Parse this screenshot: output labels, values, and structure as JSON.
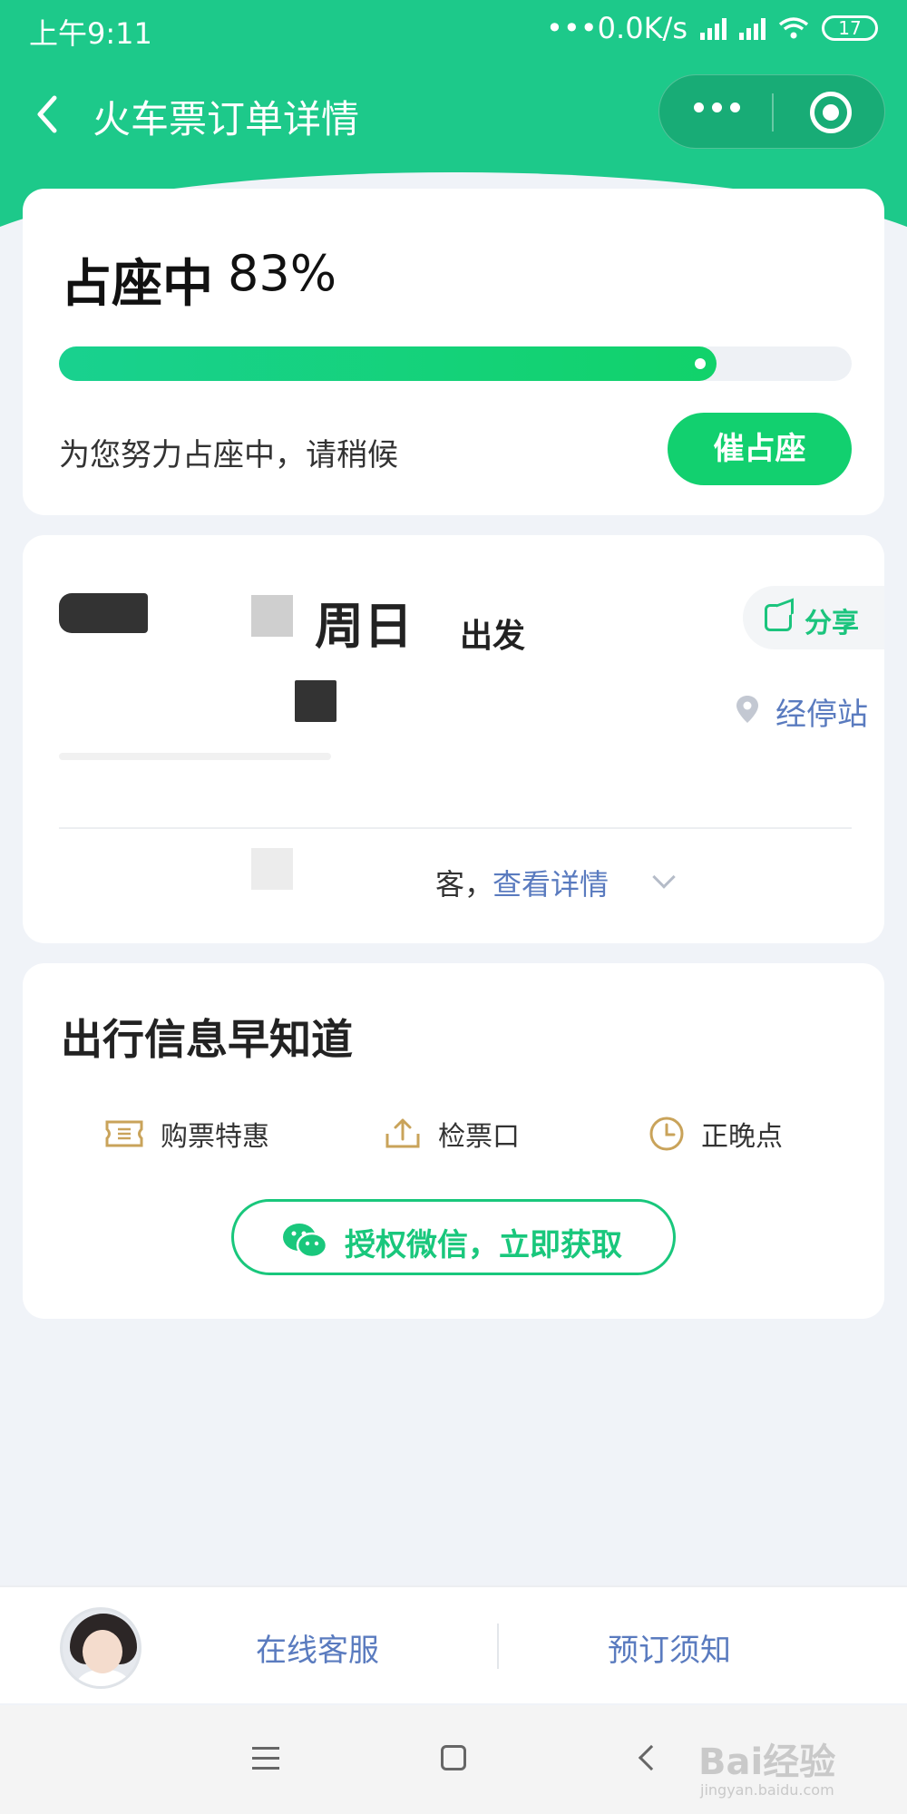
{
  "status_bar": {
    "time": "上午9:11",
    "net_speed": "•••0.0K/s",
    "battery": "17"
  },
  "nav": {
    "title": "火车票订单详情"
  },
  "progress_card": {
    "status": "占座中",
    "percent_text": "83%",
    "progress": 0.83,
    "message": "为您努力占座中，请稍候",
    "urge_button": "催占座"
  },
  "trip_card": {
    "weekday": "周日",
    "depart_label": "出发",
    "share_label": "分享",
    "stops_label": "经停站",
    "passenger_suffix": "客，",
    "view_detail": "查看详情"
  },
  "travel_info": {
    "title": "出行信息早知道",
    "features": [
      {
        "label": "购票特惠",
        "icon": "ticket-icon"
      },
      {
        "label": "检票口",
        "icon": "upload-icon"
      },
      {
        "label": "正晚点",
        "icon": "clock-icon"
      }
    ],
    "wechat_button": "授权微信，立即获取"
  },
  "bottom_bar": {
    "customer_service": "在线客服",
    "booking_notice": "预订须知"
  },
  "watermark": {
    "brand": "Bai经验",
    "url": "jingyan.baidu.com"
  },
  "colors": {
    "brand_green": "#1dc98a",
    "button_green": "#12d06f",
    "link_blue": "#5a7bbf",
    "feature_gold": "#c9a35a"
  }
}
